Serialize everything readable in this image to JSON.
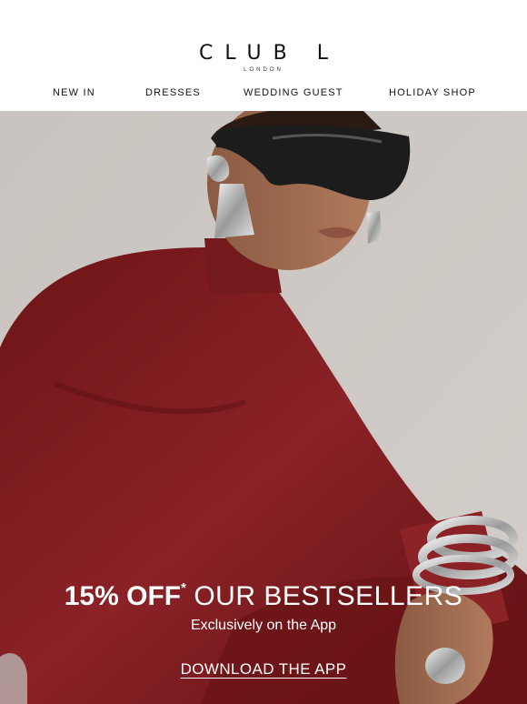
{
  "brand": {
    "name": "CLUB L",
    "sub": "LONDON"
  },
  "nav": {
    "items": [
      "NEW IN",
      "DRESSES",
      "WEDDING GUEST",
      "HOLIDAY SHOP"
    ]
  },
  "hero": {
    "headline_bold": "15% OFF",
    "headline_star": "*",
    "headline_light": "OUR BESTSELLERS",
    "subhead": "Exclusively on the App",
    "cta": "DOWNLOAD THE APP"
  },
  "colors": {
    "background": "#ffffff",
    "hero_backdrop": "#cbc6c1",
    "dress": "#7a1a1c",
    "text_light": "#ffffff"
  }
}
